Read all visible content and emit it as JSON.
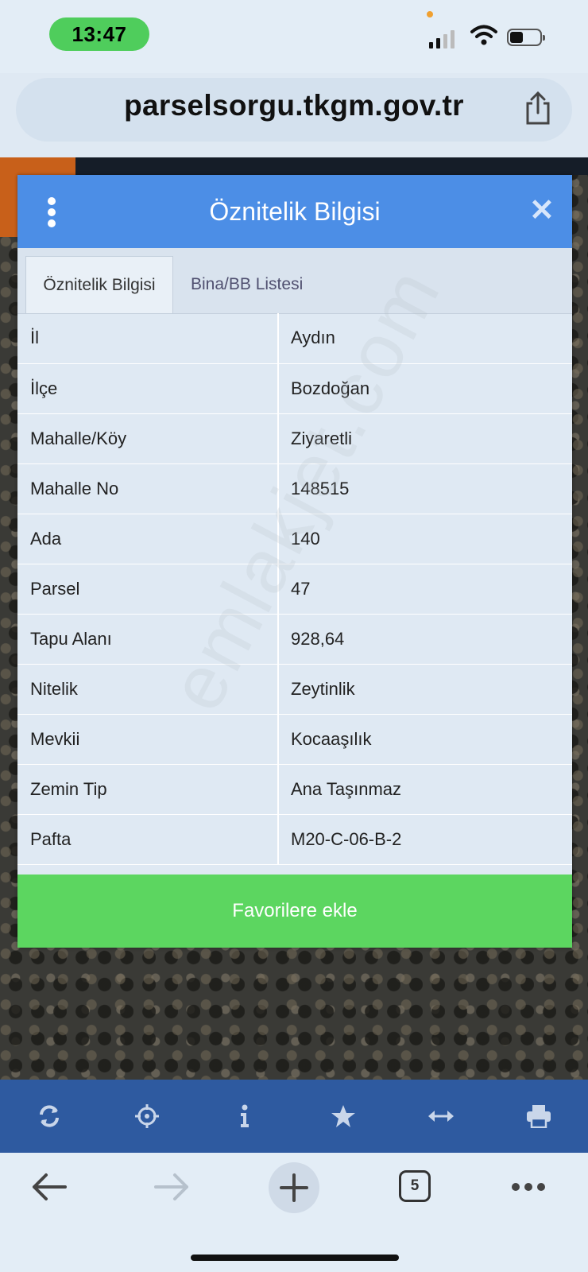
{
  "status_bar": {
    "time": "13:47"
  },
  "browser": {
    "url": "parselsorgu.tkgm.gov.tr",
    "tab_count": "5"
  },
  "panel": {
    "title": "Öznitelik Bilgisi",
    "tabs": [
      {
        "label": "Öznitelik Bilgisi",
        "active": true
      },
      {
        "label": "Bina/BB Listesi",
        "active": false
      }
    ],
    "rows": [
      {
        "key": "İl",
        "value": "Aydın"
      },
      {
        "key": "İlçe",
        "value": "Bozdoğan"
      },
      {
        "key": "Mahalle/Köy",
        "value": "Ziyaretli"
      },
      {
        "key": "Mahalle No",
        "value": "148515"
      },
      {
        "key": "Ada",
        "value": "140"
      },
      {
        "key": "Parsel",
        "value": "47"
      },
      {
        "key": "Tapu Alanı",
        "value": "928,64"
      },
      {
        "key": "Nitelik",
        "value": "Zeytinlik"
      },
      {
        "key": "Mevkii",
        "value": "Kocaaşılık"
      },
      {
        "key": "Zemin Tip",
        "value": "Ana Taşınmaz"
      },
      {
        "key": "Pafta",
        "value": "M20-C-06-B-2"
      }
    ],
    "favorite_button": "Favorilere ekle"
  },
  "watermark": "emlakjet.com",
  "map_toolbar": {
    "icons": [
      "refresh-icon",
      "locate-icon",
      "info-icon",
      "star-icon",
      "measure-icon",
      "print-icon"
    ]
  },
  "colors": {
    "header_blue": "#4c8ee6",
    "favorite_green": "#5cd660",
    "toolbar_blue": "#2e5aa0",
    "status_pill_green": "#4fcd5c"
  }
}
